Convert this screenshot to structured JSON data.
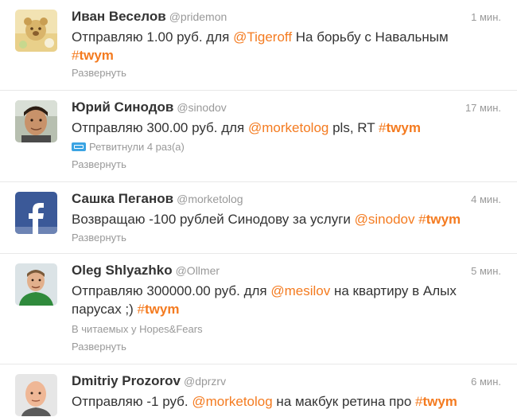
{
  "tweets": [
    {
      "fullname": "Иван Веселов",
      "username": "@pridemon",
      "time": "1 мин.",
      "avatar_icon": "teddy-bear-avatar",
      "text_pre": "Отправляю 1.00 руб. для ",
      "mention": "@Tigeroff",
      "text_post": " На борьбу с Навальным ",
      "hashtag_hash": "#",
      "hashtag_word": "twym",
      "expand": "Развернуть"
    },
    {
      "fullname": "Юрий Синодов",
      "username": "@sinodov",
      "time": "17 мин.",
      "avatar_icon": "man-photo-avatar",
      "text_pre": "Отправляю 300.00 руб. для ",
      "mention": "@morketolog",
      "text_post": " pls, RT ",
      "hashtag_hash": "#",
      "hashtag_word": "twym",
      "retweet_icon": "retweet-icon",
      "retweeted": "Ретвитнули 4 раз(а)",
      "expand": "Развернуть"
    },
    {
      "fullname": "Сашка Пеганов",
      "username": "@morketolog",
      "time": "4 мин.",
      "avatar_icon": "facebook-logo-avatar",
      "text_pre": "Возвращаю -100 рублей Синодову за услуги ",
      "mention": "@sinodov",
      "text_post": " ",
      "hashtag_hash": "#",
      "hashtag_word": "twym",
      "expand": "Развернуть"
    },
    {
      "fullname": "Oleg Shlyazhko",
      "username": "@Ollmer",
      "time": "5 мин.",
      "avatar_icon": "man-green-shirt-avatar",
      "text_pre": "Отправляю 300000.00 руб. для ",
      "mention": "@mesilov",
      "text_post": " на квартиру в Алых парусах ;) ",
      "hashtag_hash": "#",
      "hashtag_word": "twym",
      "context": "В читаемых у Hopes&Fears",
      "expand": "Развернуть"
    },
    {
      "fullname": "Dmitriy Prozorov",
      "username": "@dprzrv",
      "time": "6 мин.",
      "avatar_icon": "bald-man-avatar",
      "text_pre": "Отправляю -1 руб. ",
      "mention": "@morketolog",
      "text_post": " на макбук ретина про ",
      "hashtag_hash": "#",
      "hashtag_word": "twym"
    }
  ]
}
